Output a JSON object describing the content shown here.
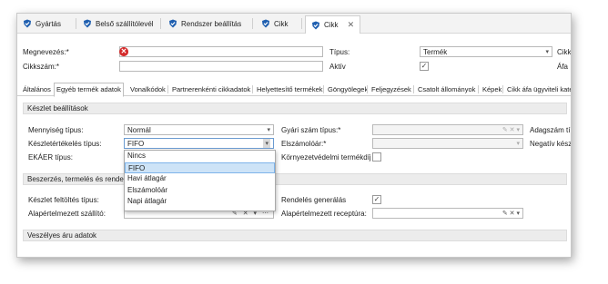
{
  "doc_tabs": [
    {
      "label": "Gyártás"
    },
    {
      "label": "Belső szállítólevél"
    },
    {
      "label": "Rendszer beállítás"
    },
    {
      "label": "Cikk"
    },
    {
      "label": "Cikk"
    }
  ],
  "header": {
    "megnevezes_label": "Megnevezés:*",
    "cikkszam_label": "Cikkszám:*",
    "tipus_label": "Típus:",
    "tipus_value": "Termék",
    "aktiv_label": "Aktív",
    "cikk_cut_label": "Cikk",
    "afa_cut_label": "Áfa"
  },
  "sub_tabs": [
    "Általános",
    "Egyéb termék adatok",
    "Vonalkódok",
    "Partnerenkénti cikkadatok",
    "Helyettesítő termékek",
    "Göngyölegek",
    "Feljegyzések",
    "Csatolt állományok",
    "Képek",
    "Cikk áfa ügyviteli kate"
  ],
  "sections": {
    "keszlet": "Készlet beállítások",
    "beszerzes": "Beszerzés, termelés és rende",
    "veszelyes": "Veszélyes áru adatok"
  },
  "keszlet": {
    "mennyiseg_label": "Mennyiség típus:",
    "mennyiseg_value": "Normál",
    "keszletert_label": "Készletértékelés típus:",
    "keszletert_value": "FIFO",
    "ekaer_label": "EKÁER típus:",
    "gyari_label": "Gyári szám típus:*",
    "elszamolo_label": "Elszámolóár:*",
    "korny_label": "Környezetvédelmi termékdíj",
    "adagszam_label": "Adagszám típu",
    "negativ_label": "Negatív készle"
  },
  "dropdown_options": [
    "Nincs",
    "FIFO",
    "Havi átlagár",
    "Elszámolóár",
    "Napi átlagár"
  ],
  "beszerzes": {
    "feltoltes_label": "Készlet feltöltés típus:",
    "alap_szallito_label": "Alapértelmezett szállító:",
    "rendelés_label": "Rendelés generálás",
    "receptura_label": "Alapértelmezett receptúra:"
  },
  "icons": {
    "tab_icon": "shield-icon",
    "tab_icon_color": "#1f5fb0",
    "error_color": "#d42b2b"
  }
}
